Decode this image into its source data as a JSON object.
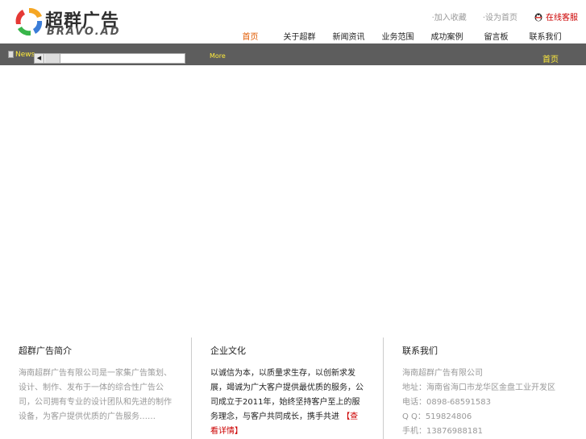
{
  "header": {
    "logo_cn": "超群广告",
    "logo_en": "BRAVO.AD",
    "top_links": [
      "·加入收藏",
      "·设为首页"
    ],
    "qq_label": "在线客服",
    "nav": [
      {
        "label": "首页",
        "active": true
      },
      {
        "label": "关于超群"
      },
      {
        "label": "新闻资讯"
      },
      {
        "label": "业务范围"
      },
      {
        "label": "成功案例"
      },
      {
        "label": "留言板"
      },
      {
        "label": "联系我们"
      }
    ]
  },
  "bar": {
    "news_label": "News",
    "more_label": "More",
    "right_label": "首页"
  },
  "footer": {
    "col1": {
      "title": "超群广告简介",
      "text": "海南超群广告有限公司是一家集广告策划、设计、制作、发布于一体的综合性广告公司，公司拥有专业的设计团队和先进的制作设备，为客户提供优质的广告服务……"
    },
    "col2": {
      "title": "企业文化",
      "text": "以诚信为本，以质量求生存，以创新求发展，竭诚为广大客户提供最优质的服务，公司成立于2011年，始终坚持客户至上的服务理念，与客户共同成长，携手共进",
      "link": "【查看详情】"
    },
    "col3": {
      "title": "联系我们",
      "lines": [
        "海南超群广告有限公司",
        "地址：海南省海口市龙华区金盘工业开发区",
        "电话：0898-68591583",
        "Q  Q：519824806",
        "手机：13876988181"
      ]
    }
  }
}
